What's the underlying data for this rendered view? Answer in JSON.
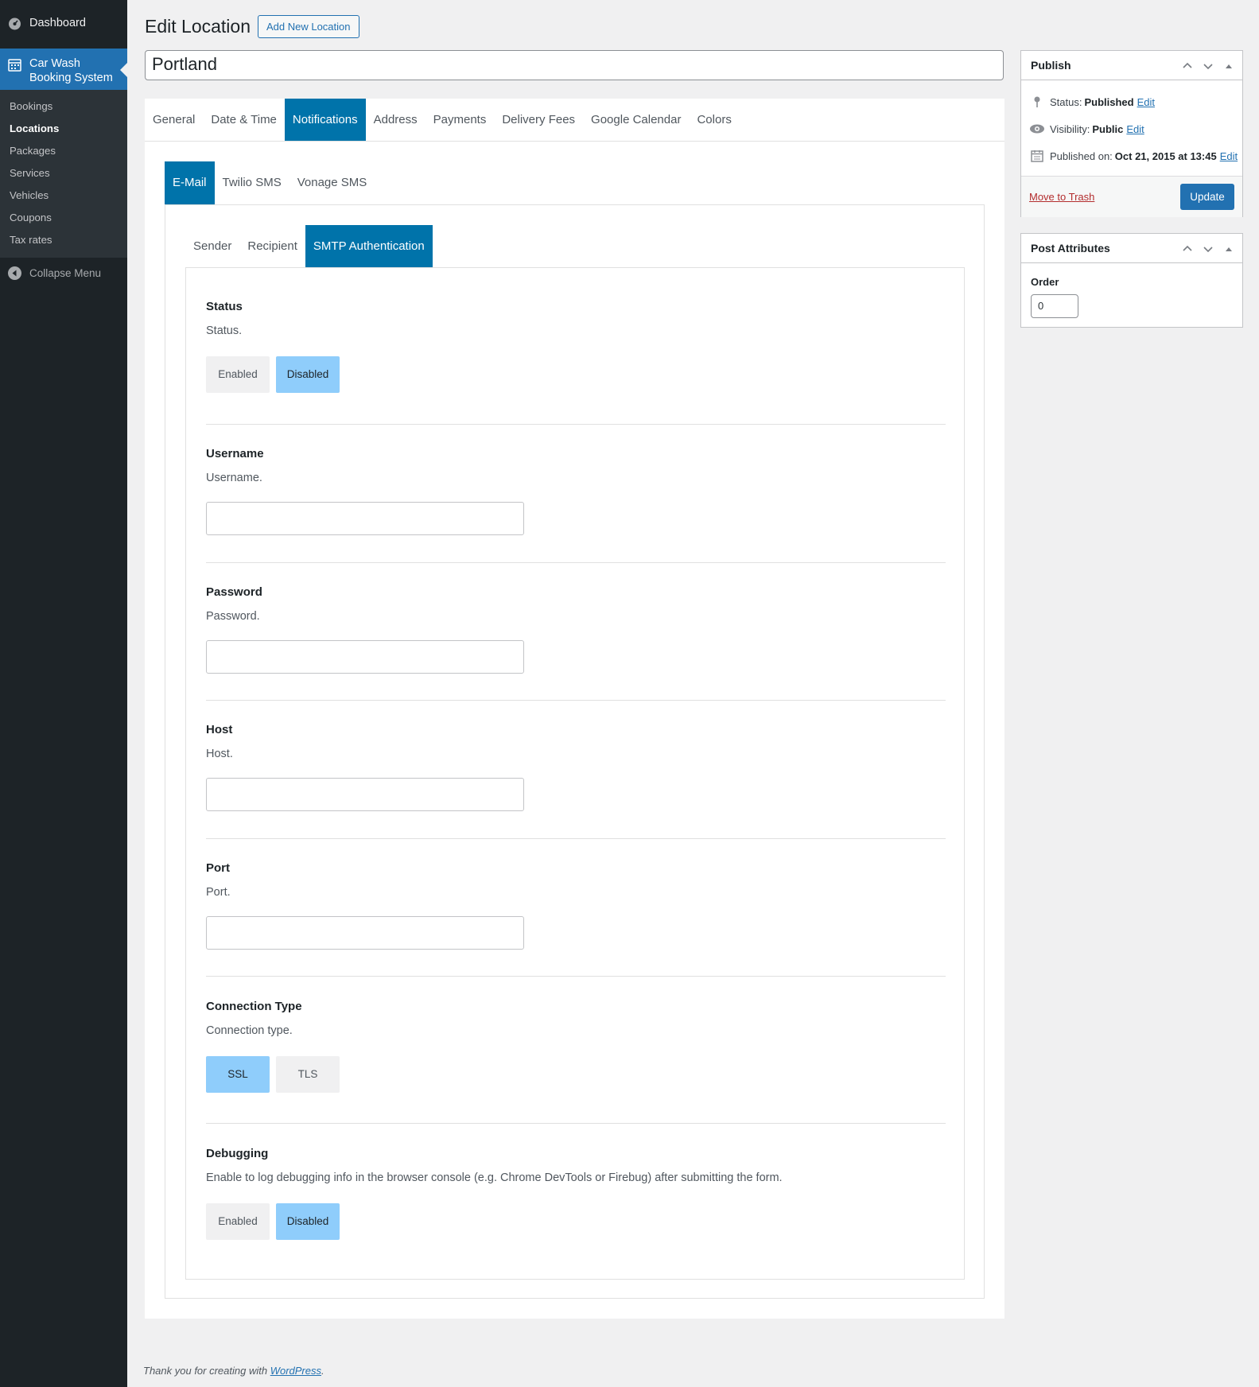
{
  "sidebar": {
    "dashboard": "Dashboard",
    "current": "Car Wash Booking System",
    "items": [
      "Bookings",
      "Locations",
      "Packages",
      "Services",
      "Vehicles",
      "Coupons",
      "Tax rates"
    ],
    "active_item": "Locations",
    "collapse": "Collapse Menu"
  },
  "header": {
    "title": "Edit Location",
    "add_new": "Add New Location",
    "post_title": "Portland"
  },
  "tabs_l1": [
    "General",
    "Date & Time",
    "Notifications",
    "Address",
    "Payments",
    "Delivery Fees",
    "Google Calendar",
    "Colors"
  ],
  "tabs_l1_active": "Notifications",
  "tabs_l2": [
    "E-Mail",
    "Twilio SMS",
    "Vonage SMS"
  ],
  "tabs_l2_active": "E-Mail",
  "tabs_l3": [
    "Sender",
    "Recipient",
    "SMTP Authentication"
  ],
  "tabs_l3_active": "SMTP Authentication",
  "fields": {
    "status": {
      "label": "Status",
      "desc": "Status.",
      "options": [
        "Enabled",
        "Disabled"
      ],
      "selected": "Disabled"
    },
    "username": {
      "label": "Username",
      "desc": "Username.",
      "value": ""
    },
    "password": {
      "label": "Password",
      "desc": "Password.",
      "value": ""
    },
    "host": {
      "label": "Host",
      "desc": "Host.",
      "value": ""
    },
    "port": {
      "label": "Port",
      "desc": "Port.",
      "value": ""
    },
    "connection": {
      "label": "Connection Type",
      "desc": "Connection type.",
      "options": [
        "SSL",
        "TLS"
      ],
      "selected": "SSL"
    },
    "debugging": {
      "label": "Debugging",
      "desc": "Enable to log debugging info in the browser console (e.g. Chrome DevTools or Firebug) after submitting the form.",
      "options": [
        "Enabled",
        "Disabled"
      ],
      "selected": "Disabled"
    }
  },
  "publish": {
    "title": "Publish",
    "status_label": "Status:",
    "status_value": "Published",
    "visibility_label": "Visibility:",
    "visibility_value": "Public",
    "published_label": "Published on:",
    "published_value": "Oct 21, 2015 at 13:45",
    "edit": "Edit",
    "trash": "Move to Trash",
    "update": "Update"
  },
  "attributes": {
    "title": "Post Attributes",
    "order_label": "Order",
    "order_value": "0"
  },
  "footer": {
    "text": "Thank you for creating with",
    "link": "WordPress",
    "period": "."
  },
  "colors": {
    "sidebar_bg": "#1d2327",
    "accent": "#2271b1",
    "tab_active": "#0073aa",
    "option_selected": "#8fcdfb"
  }
}
